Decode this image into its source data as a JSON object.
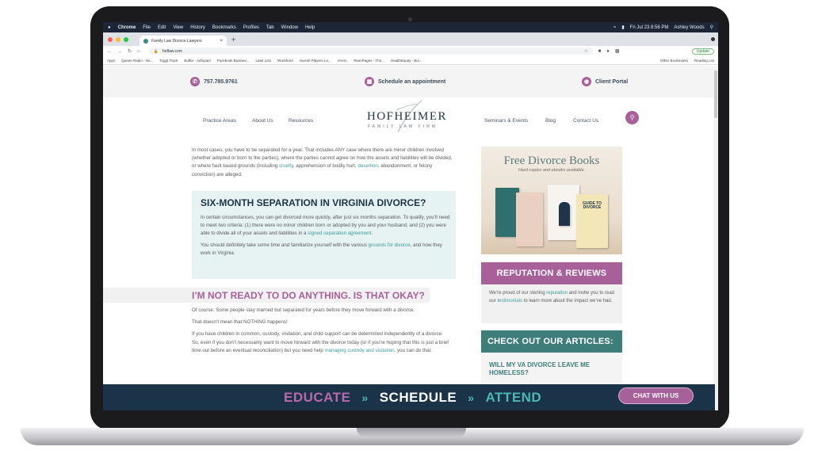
{
  "menubar": {
    "app": "Chrome",
    "items": [
      "File",
      "Edit",
      "View",
      "History",
      "Bookmarks",
      "Profiles",
      "Tab",
      "Window",
      "Help"
    ],
    "clock": "Fri Jul 23  8:56 PM",
    "user": "Ashley Woods"
  },
  "browser": {
    "tab_title": "Family Law Divorce Lawyers",
    "url": "hoflaw.com",
    "update_label": "Update",
    "bookmarks": [
      "Apps",
      "Queen Radio - No...",
      "Toggl Track",
      "Buffer - Admpact",
      "Facebook Busines...",
      "Later.com",
      "Workfront",
      "Hurrah Players Lo...",
      "VAHA",
      "TeamPages - The...",
      "HealthEquity - Bui..."
    ],
    "bookmarks_right": [
      "Other Bookmarks",
      "Reading List"
    ]
  },
  "topbar": {
    "phone": "757.785.9761",
    "schedule": "Schedule an appointment",
    "portal": "Client Portal"
  },
  "header": {
    "nav_left": [
      "Practice Areas",
      "About Us",
      "Resources"
    ],
    "logo_main": "HOFHEIMER",
    "logo_sub": "FAMILY LAW FIRM",
    "nav_right": [
      "Seminars & Events",
      "Blog",
      "Contact Us"
    ]
  },
  "content": {
    "intro_a": "In most cases, you have to be separated for a year. That includes ANY case where there are minor children involved (whether adopted or born to the parties), where the parties cannot agree on how the assets and liabilities will be divided, or where fault based grounds (including ",
    "intro_link1": "cruelty",
    "intro_b": ", apprehension of bodily hurt, ",
    "intro_link2": "desertion",
    "intro_c": ", abandonment, or felony conviction) are alleged.",
    "sep_heading": "SIX-MONTH SEPARATION IN VIRGINIA DIVORCE?",
    "sep_p1_a": "In certain circumstances, you can get divorced more quickly, after just six months separation. To qualify, you’ll need to meet two criteria: (1) there were no minor children born or adopted by you and your husband, and (2) you were able to divide all of your assets and liabilities in a ",
    "sep_p1_link": "signed separation agreement",
    "sep_p1_b": ".",
    "sep_p2_a": "You should definitely take some time and familiarize yourself with the various ",
    "sep_p2_link": "grounds for divorce",
    "sep_p2_b": ", and how they work in Virginia.",
    "not_ready_heading": "I’M NOT READY TO DO ANYTHING. IS THAT OKAY?",
    "nr_p1": "Of course. Some people stay married but separated for years before they move forward with a divorce.",
    "nr_p2": "That doesn’t mean that NOTHING happens!",
    "nr_p3_a": "If you have children in common, custody, visitation, and child support can be determined independently of a divorce. So, even if you don’t necessarily want to move forward with the divorce today (or if you’re hoping that this is just a brief time out before an eventual reconciliation) but you need help ",
    "nr_p3_link": "managing custody and visitation",
    "nr_p3_b": ", you can do that."
  },
  "sidebar": {
    "books_title": "Free Divorce Books",
    "books_subtitle": "Hard copies and ebooks available.",
    "book_cover_label": "GUIDE TO DIVORCE",
    "rep_heading": "REPUTATION & REVIEWS",
    "rep_a": "We’re proud of our sterling ",
    "rep_link1": "reputation",
    "rep_b": " and invite you to read our ",
    "rep_link2": "testimonials",
    "rep_c": " to learn more about the impact we’ve had.",
    "articles_heading": "CHECK OUT OUR ARTICLES:",
    "article_1": "WILL MY VA DIVORCE LEAVE ME HOMELESS?"
  },
  "banner": {
    "educate": "EDUCATE",
    "raquo1": "»",
    "schedule": "SCHEDULE",
    "raquo2": "»",
    "attend": "ATTEND",
    "chat": "CHAT WITH US"
  },
  "colors": {
    "brand_purple": "#a8609b",
    "brand_teal": "#3d7e7a",
    "brand_navy": "#1a3348",
    "link_teal": "#3b9d9b"
  }
}
